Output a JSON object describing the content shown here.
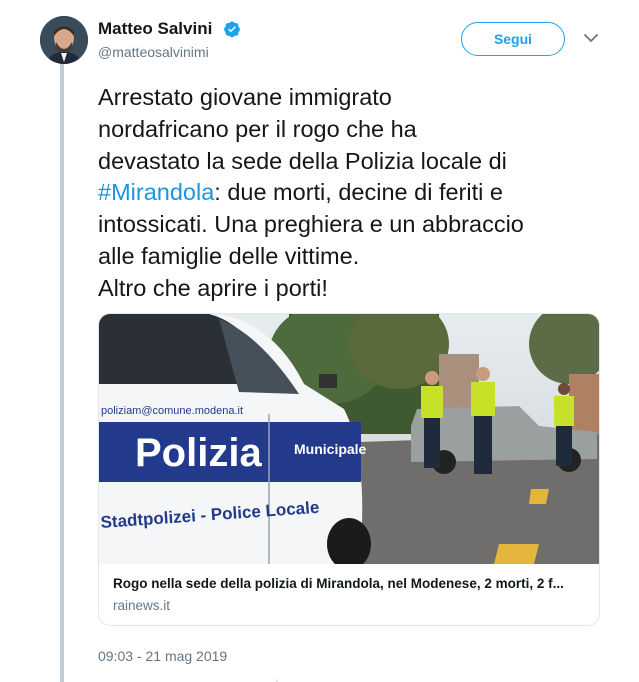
{
  "author": {
    "name": "Matteo Salvini",
    "handle": "@matteosalvinimi",
    "verified": true
  },
  "follow_button": {
    "label": "Segui"
  },
  "tweet": {
    "lines": [
      "Arrestato giovane immigrato",
      "nordafricano per il rogo che ha",
      "devastato la sede della Polizia locale di",
      "",
      "intossicati. Una preghiera e un abbraccio",
      "alle famiglie delle vittime.",
      "Altro che aprire i porti!"
    ],
    "hashtag": "#Mirandola",
    "line4_rest": ": due morti, decine di feriti e"
  },
  "card": {
    "image_text": {
      "email": "poliziam@comune.modena.it",
      "brand": "Polizia",
      "unit": "Municipale",
      "subtitle": "Stadtpolizei - Police Locale"
    },
    "title": "Rogo nella sede della polizia di Mirandola, nel Modenese, 2 morti, 2 f...",
    "domain": "rainews.it"
  },
  "timestamp": "09:03 - 21 mag 2019",
  "colors": {
    "link": "#1b95e0",
    "follow": "#1da1f2",
    "secondary_text": "#657786",
    "thread_line": "#c3ccd3"
  }
}
